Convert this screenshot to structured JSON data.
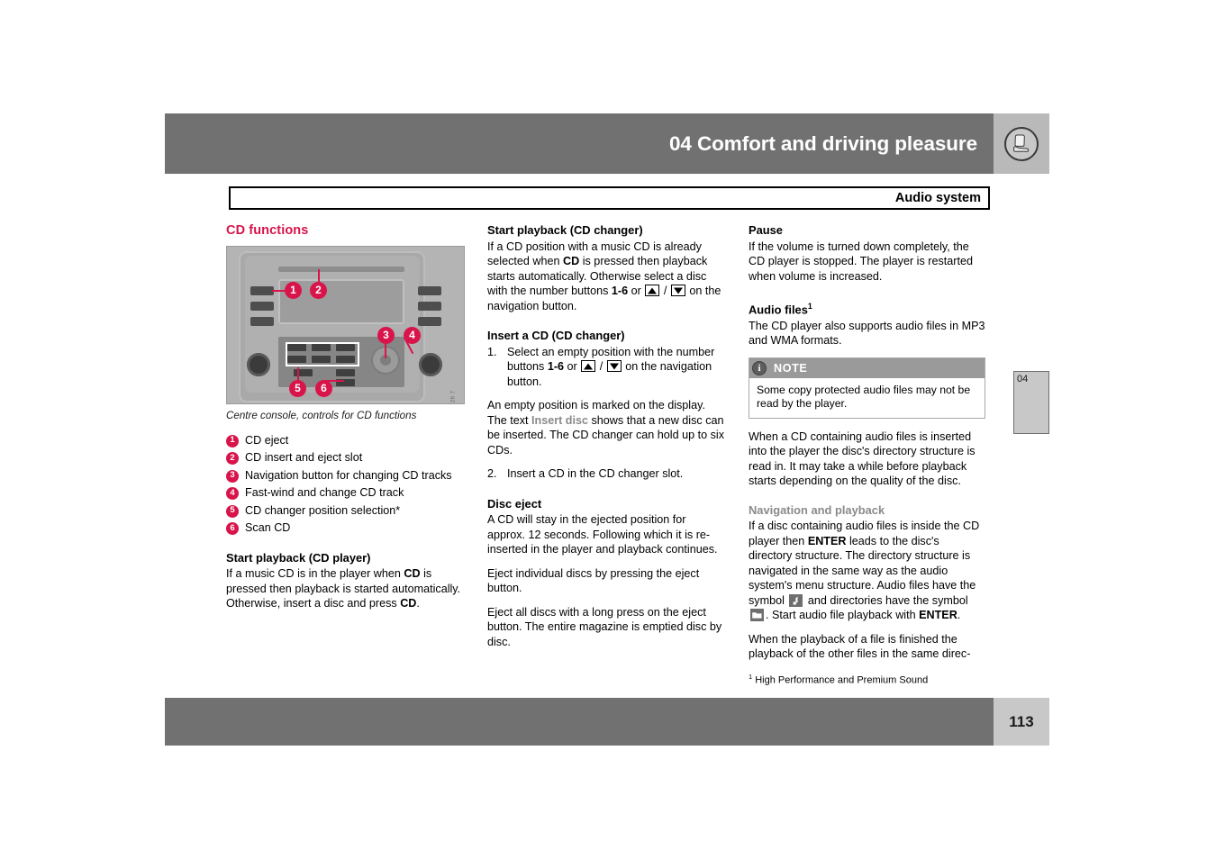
{
  "header": {
    "title": "04 Comfort and driving pleasure",
    "icon": "car-seat-icon",
    "band_color": "#717171"
  },
  "section_tab": {
    "label": "Audio system"
  },
  "chapter_tab": {
    "number": "04"
  },
  "footer": {
    "page_number": "113"
  },
  "column1": {
    "heading": "CD functions",
    "figure": {
      "caption": "Centre console, controls for CD functions",
      "image_code": "G011026 7",
      "callouts": [
        "1",
        "2",
        "3",
        "4",
        "5",
        "6"
      ]
    },
    "legend": [
      {
        "num": "1",
        "text": "CD eject"
      },
      {
        "num": "2",
        "text": "CD insert and eject slot"
      },
      {
        "num": "3",
        "text": "Navigation button for changing CD tracks"
      },
      {
        "num": "4",
        "text": "Fast-wind and change CD track"
      },
      {
        "num": "5",
        "text": "CD changer position selection*"
      },
      {
        "num": "6",
        "text": "Scan CD"
      }
    ],
    "start_playback_player": {
      "heading": "Start playback (CD player)",
      "body_a": "If a music CD is in the player when ",
      "bold_1": "CD",
      "body_b": " is pressed then playback is started automatically. Otherwise, insert a disc and press ",
      "bold_2": "CD",
      "body_c": "."
    }
  },
  "column2": {
    "start_playback_changer": {
      "heading": "Start playback (CD changer)",
      "text_a": "If a CD position with a music CD is already selected when ",
      "bold_1": "CD",
      "text_b": " is pressed then playback starts automatically. Otherwise select a disc with the number buttons ",
      "bold_2": "1-6",
      "text_c": " or ",
      "arrow_up": "up-arrow-key",
      "text_d": " / ",
      "arrow_down": "down-arrow-key",
      "text_e": " on the navigation button."
    },
    "insert_cd": {
      "heading": "Insert a CD (CD changer)",
      "step1_num": "1.",
      "step1_a": "Select an empty position with the number buttons ",
      "step1_bold": "1-6",
      "step1_b": " or ",
      "step1_c": " / ",
      "step1_d": " on the navigation button.",
      "para_a": "An empty position is marked on the display. The text ",
      "grey_term": "Insert disc",
      "para_b": " shows that a new disc can be inserted. The CD changer can hold up to six CDs.",
      "step2_num": "2.",
      "step2_text": "Insert a CD in the CD changer slot."
    },
    "disc_eject": {
      "heading": "Disc eject",
      "para1": "A CD will stay in the ejected position for approx. 12 seconds. Following which it is re-inserted in the player and playback continues.",
      "para2": "Eject individual discs by pressing the eject button.",
      "para3": "Eject all discs with a long press on the eject button. The entire magazine is emptied disc by disc."
    }
  },
  "column3": {
    "pause": {
      "heading": "Pause",
      "body": "If the volume is turned down completely, the CD player is stopped. The player is restarted when volume is increased."
    },
    "audio_files": {
      "heading": "Audio files",
      "heading_sup": "1",
      "body": "The CD player also supports audio files in MP3 and WMA formats."
    },
    "note": {
      "icon": "info-icon",
      "title": "NOTE",
      "body": "Some copy protected audio files may not be read by the player."
    },
    "after_note": "When a CD containing audio files is inserted into the player the disc's directory structure is read in. It may take a while before playback starts depending on the quality of the disc.",
    "navigation": {
      "heading": "Navigation and playback",
      "text_a": "If a disc containing audio files is inside the CD player then ",
      "bold_1": "ENTER",
      "text_b": " leads to the disc's directory structure. The directory structure is navigated in the same way as the audio system's menu structure. Audio files have the symbol ",
      "chip_note": "music-note-symbol",
      "text_c": " and directories have the symbol ",
      "chip_folder": "folder-symbol",
      "text_d": ". Start audio file playback with ",
      "bold_2": "ENTER",
      "text_e": "."
    },
    "last_para": "When the playback of a file is finished the playback of the other files in the same direc-",
    "footnote": {
      "marker": "1",
      "text": "High Performance and Premium Sound"
    }
  }
}
